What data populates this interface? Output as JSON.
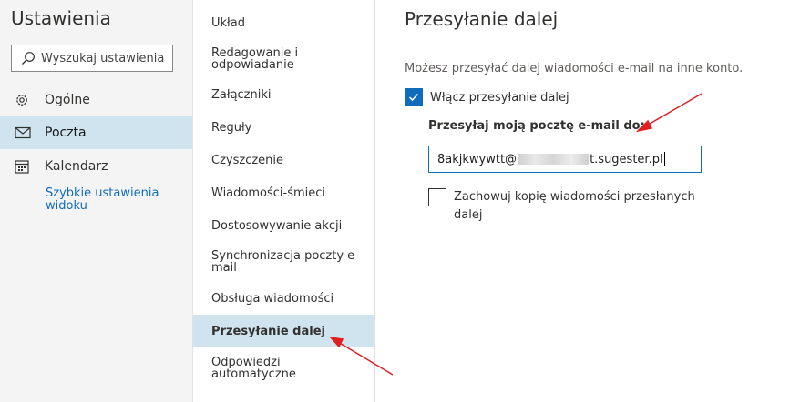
{
  "left_panel": {
    "title": "Ustawienia",
    "search": {
      "placeholder": "Wyszukaj ustawienia",
      "icon": "search-icon"
    },
    "nav": [
      {
        "label": "Ogólne",
        "icon": "gear-icon"
      },
      {
        "label": "Poczta",
        "icon": "mail-icon",
        "active": true
      },
      {
        "label": "Kalendarz",
        "icon": "calendar-icon"
      }
    ],
    "quick_settings_link": "Szybkie ustawienia widoku"
  },
  "middle_panel": {
    "items": [
      {
        "label": "Układ"
      },
      {
        "label": "Redagowanie i odpowiadanie"
      },
      {
        "label": "Załączniki"
      },
      {
        "label": "Reguły"
      },
      {
        "label": "Czyszczenie"
      },
      {
        "label": "Wiadomości-śmieci"
      },
      {
        "label": "Dostosowywanie akcji"
      },
      {
        "label": "Synchronizacja poczty e-mail"
      },
      {
        "label": "Obsługa wiadomości"
      },
      {
        "label": "Przesyłanie dalej",
        "active": true
      },
      {
        "label": "Odpowiedzi automatyczne"
      }
    ]
  },
  "main": {
    "title": "Przesyłanie dalej",
    "description": "Możesz przesyłać dalej wiadomości e-mail na inne konto.",
    "enable_forwarding": {
      "label": "Włącz przesyłanie dalej",
      "checked": true
    },
    "forward_to_label": "Przesyłaj moją pocztę e-mail do:",
    "email_value_start": "8akjkwywtt@",
    "email_value_end": "t.sugester.pl",
    "keep_copy": {
      "label": "Zachowuj kopię wiadomości przesłanych dalej",
      "checked": false
    }
  },
  "colors": {
    "accent": "#0f6cbd",
    "selected_bg": "#cfe4ee",
    "annotation_arrow": "#e02020"
  }
}
